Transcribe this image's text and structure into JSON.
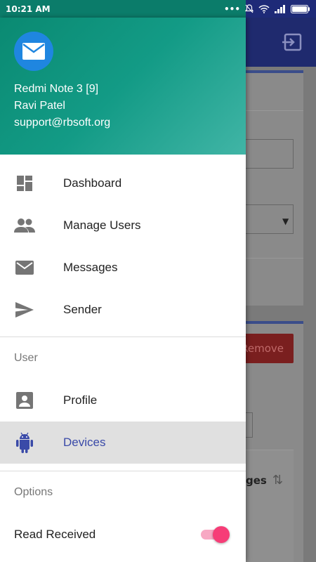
{
  "status_bar": {
    "time": "10:21 AM"
  },
  "drawer": {
    "header": {
      "device": "Redmi Note 3 [9]",
      "user_name": "Ravi Patel",
      "email": "support@rbsoft.org"
    },
    "main_items": [
      {
        "label": "Dashboard",
        "icon": "dashboard-icon"
      },
      {
        "label": "Manage Users",
        "icon": "people-icon"
      },
      {
        "label": "Messages",
        "icon": "mail-icon"
      },
      {
        "label": "Sender",
        "icon": "send-icon"
      }
    ],
    "user_section": {
      "title": "User",
      "items": [
        {
          "label": "Profile",
          "icon": "person-icon"
        },
        {
          "label": "Devices",
          "icon": "android-icon",
          "active": true
        }
      ]
    },
    "options_section": {
      "title": "Options",
      "read_received": {
        "label": "Read Received",
        "enabled": true
      }
    }
  },
  "background": {
    "remove_label": "Remove",
    "table_header": "ges"
  },
  "colors": {
    "accent": "#3a4aa8",
    "header": "#0a8a72",
    "toggle": "#f63d77"
  }
}
